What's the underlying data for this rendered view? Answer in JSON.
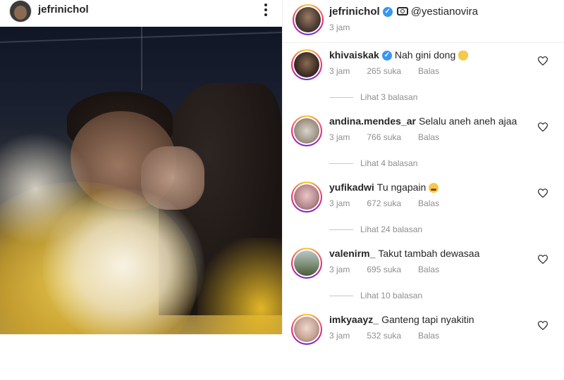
{
  "post": {
    "author": "jefrinichol",
    "tagged": "@yestianovira",
    "time": "3 jam"
  },
  "comments": [
    {
      "user": "khivaiskak",
      "verified": true,
      "text": "Nah gini dong",
      "emoji": "pointing-hand-emoji",
      "time": "3 jam",
      "likes": "265 suka",
      "reply": "Balas",
      "replies": "Lihat 3 balasan"
    },
    {
      "user": "andina.mendes_ar",
      "verified": false,
      "text": "Selalu aneh aneh ajaa",
      "time": "3 jam",
      "likes": "766 suka",
      "reply": "Balas",
      "replies": "Lihat 4 balasan"
    },
    {
      "user": "yufikadwi",
      "verified": false,
      "text": "Tu ngapain",
      "emoji": "crying-face-emoji",
      "time": "3 jam",
      "likes": "672 suka",
      "reply": "Balas",
      "replies": "Lihat 24 balasan"
    },
    {
      "user": "valenirm_",
      "verified": false,
      "text": "Takut tambah dewasaa",
      "time": "3 jam",
      "likes": "695 suka",
      "reply": "Balas",
      "replies": "Lihat 10 balasan"
    },
    {
      "user": "imkyaayz_",
      "verified": false,
      "text": "Ganteng tapi nyakitin",
      "time": "3 jam",
      "likes": "532 suka",
      "reply": "Balas"
    }
  ],
  "colors": {
    "text": "#262626",
    "muted": "#8e8e8e",
    "verified": "#3897f0",
    "ring_start": "#f9ce34",
    "ring_mid": "#ee2a7b",
    "ring_end": "#6228d7"
  },
  "icons": {
    "more": "more-vertical-icon",
    "verified": "verified-badge-icon",
    "camera": "camera-icon",
    "like": "heart-icon"
  }
}
